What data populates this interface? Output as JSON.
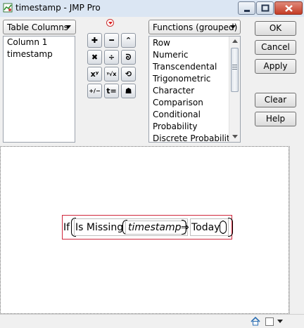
{
  "window": {
    "title": "timestamp - JMP Pro"
  },
  "columns_dropdown": {
    "label": "Table Columns"
  },
  "columns_list": {
    "items": [
      "Column 1",
      "timestamp"
    ]
  },
  "functions_dropdown": {
    "label": "Functions (grouped)"
  },
  "functions_list": {
    "items": [
      "Row",
      "Numeric",
      "Transcendental",
      "Trigonometric",
      "Character",
      "Comparison",
      "Conditional",
      "Probability",
      "Discrete Probability"
    ]
  },
  "operators": [
    {
      "name": "add-button",
      "glyph": "✚"
    },
    {
      "name": "subtract-button",
      "glyph": "━"
    },
    {
      "name": "raise-button",
      "glyph": "⌃"
    },
    {
      "name": "multiply-button",
      "glyph": "✖"
    },
    {
      "name": "divide-button",
      "glyph": "÷"
    },
    {
      "name": "local-variable-button",
      "glyph": "ᘐ"
    },
    {
      "name": "power-button",
      "glyph": "xʸ"
    },
    {
      "name": "root-button",
      "glyph": "ʸ√x"
    },
    {
      "name": "swap-button",
      "glyph": "⟲"
    },
    {
      "name": "unary-minus-button",
      "glyph": "+/−"
    },
    {
      "name": "assign-button",
      "glyph": "t="
    },
    {
      "name": "peel-button",
      "glyph": "☗"
    }
  ],
  "buttons": {
    "ok": "OK",
    "cancel": "Cancel",
    "apply": "Apply",
    "clear": "Clear",
    "help": "Help"
  },
  "formula": {
    "if_keyword": "If",
    "function": "Is Missing",
    "argument": "timestamp",
    "arrow": "⇒",
    "result": "Today"
  },
  "colors": {
    "formula_border": "#d0273c",
    "title_bar": "#dbe6f3",
    "panel": "#f0f0f0"
  },
  "status_icons": [
    "home-icon",
    "checkbox-icon",
    "dropdown-arrow-icon"
  ]
}
